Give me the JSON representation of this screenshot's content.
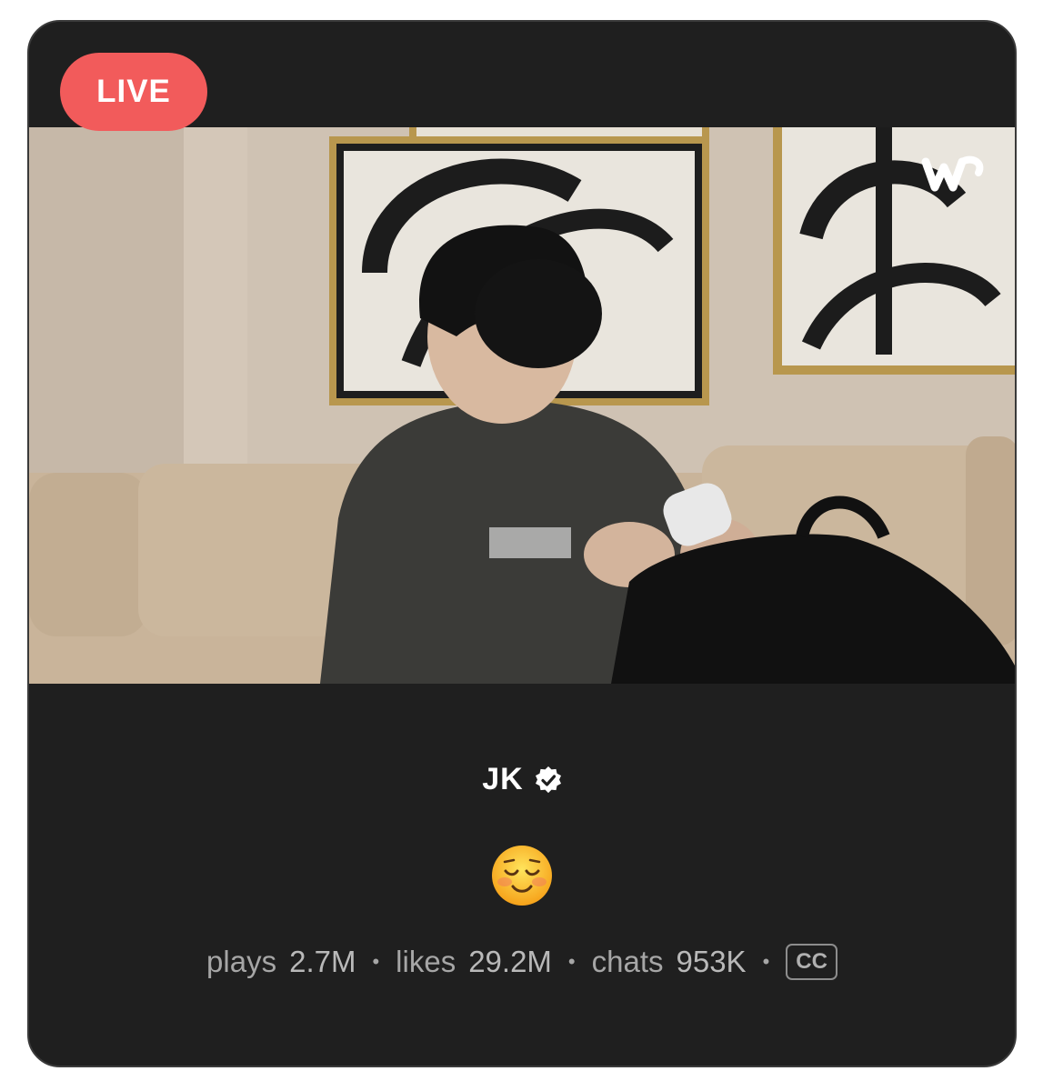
{
  "badge": {
    "label": "LIVE",
    "color": "#f25b5b"
  },
  "video": {
    "brand_icon": "weverse-logo-icon",
    "description_icon": "live-video-frame"
  },
  "channel": {
    "name": "JK",
    "verified_icon": "verified-badge-icon"
  },
  "post": {
    "emoji": "☺️",
    "emoji_icon": "smiling-face-icon"
  },
  "stats": {
    "plays_label": "plays",
    "plays_value": "2.7M",
    "likes_label": "likes",
    "likes_value": "29.2M",
    "chats_label": "chats",
    "chats_value": "953K",
    "separator": "•",
    "cc_label": "CC"
  },
  "colors": {
    "card_bg": "#1f1f1f",
    "text_primary": "#ffffff",
    "text_secondary": "#a6a6a6"
  }
}
